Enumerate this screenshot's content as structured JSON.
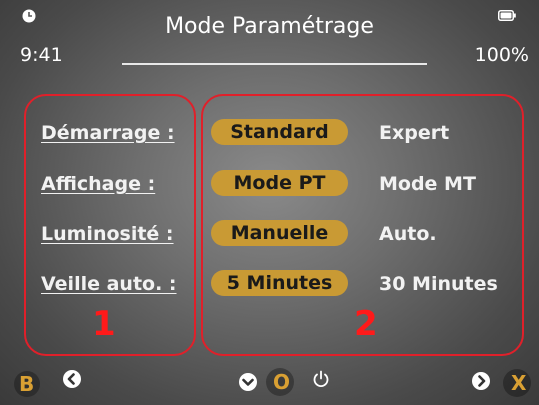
{
  "status": {
    "time": "9:41",
    "title": "Mode Paramétrage",
    "battery": "100%",
    "icons": [
      "clock-icon",
      "battery-icon"
    ]
  },
  "settings": [
    {
      "label": "Démarrage :",
      "selected": "Standard",
      "alternative": "Expert"
    },
    {
      "label": "Affichage :",
      "selected": "Mode PT",
      "alternative": "Mode MT"
    },
    {
      "label": "Luminosité :",
      "selected": "Manuelle",
      "alternative": "Auto."
    },
    {
      "label": "Veille auto. :",
      "selected": "5 Minutes",
      "alternative": "30 Minutes"
    }
  ],
  "annotations": {
    "left_number": "1",
    "right_number": "2"
  },
  "bottombar": {
    "left_key": "B",
    "ok_key": "O",
    "right_key": "X",
    "icons": [
      "back-icon",
      "chevron-left-icon",
      "chevron-down-icon",
      "ok-icon",
      "power-icon",
      "chevron-right-icon",
      "close-key-icon"
    ]
  },
  "colors": {
    "accent": "#c99a34",
    "annotation": "#e0202a",
    "key": "#d9a033"
  }
}
